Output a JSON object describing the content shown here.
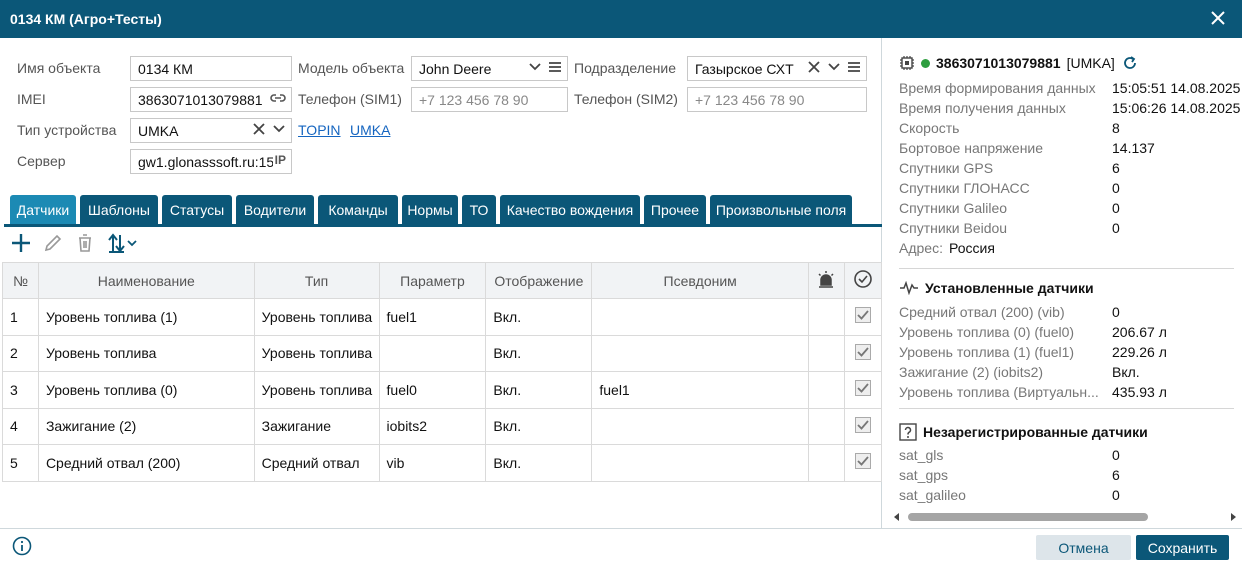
{
  "window": {
    "title": "0134 КМ (Агро+Тесты)"
  },
  "form": {
    "object_name_label": "Имя объекта",
    "object_name_value": "0134 КМ",
    "model_label": "Модель объекта",
    "model_value": "John Deere",
    "division_label": "Подразделение",
    "division_value": "Газырское СХТ",
    "imei_label": "IMEI",
    "imei_value": "3863071013079881",
    "phone1_label": "Телефон (SIM1)",
    "phone1_placeholder": "+7 123 456 78 90",
    "phone2_label": "Телефон (SIM2)",
    "phone2_placeholder": "+7 123 456 78 90",
    "device_type_label": "Тип устройства",
    "device_type_value": "UMKA",
    "link_topin": "TOPIN",
    "link_umka": "UMKA",
    "server_label": "Сервер",
    "server_value": "gw1.glonasssoft.ru:15"
  },
  "tabs": [
    "Датчики",
    "Шаблоны",
    "Статусы",
    "Водители",
    "Команды",
    "Нормы",
    "ТО",
    "Качество вождения",
    "Прочее",
    "Произвольные поля"
  ],
  "table": {
    "headers": [
      "№",
      "Наименование",
      "Тип",
      "Параметр",
      "Отображение",
      "Псевдоним"
    ],
    "rows": [
      [
        "1",
        "Уровень топлива (1)",
        "Уровень топлива",
        "fuel1",
        "Вкл.",
        ""
      ],
      [
        "2",
        "Уровень топлива",
        "Уровень топлива",
        "",
        "Вкл.",
        ""
      ],
      [
        "3",
        "Уровень топлива (0)",
        "Уровень топлива",
        "fuel0",
        "Вкл.",
        "fuel1"
      ],
      [
        "4",
        "Зажигание (2)",
        "Зажигание",
        "iobits2",
        "Вкл.",
        ""
      ],
      [
        "5",
        "Средний отвал (200)",
        "Средний отвал",
        "vib",
        "Вкл.",
        ""
      ]
    ]
  },
  "info": {
    "device_id": "3863071013079881",
    "device_type": "[UMKA]",
    "rows": [
      [
        "Время формирования данных",
        "15:05:51 14.08.2025"
      ],
      [
        "Время получения данных",
        "15:06:26 14.08.2025"
      ],
      [
        "Скорость",
        "8"
      ],
      [
        "Бортовое напряжение",
        "14.137"
      ],
      [
        "Спутники GPS",
        "6"
      ],
      [
        "Спутники ГЛОНАСС",
        "0"
      ],
      [
        "Спутники Galileo",
        "0"
      ],
      [
        "Спутники Beidou",
        "0"
      ]
    ],
    "address_label": "Адрес:",
    "address_value": "Россия",
    "installed_title": "Установленные датчики",
    "installed": [
      [
        "Средний отвал (200) (vib)",
        "0"
      ],
      [
        "Уровень топлива (0) (fuel0)",
        "206.67 л"
      ],
      [
        "Уровень топлива (1) (fuel1)",
        "229.26 л"
      ],
      [
        "Зажигание (2) (iobits2)",
        "Вкл."
      ],
      [
        "Уровень топлива (Виртуальн...",
        "435.93 л"
      ]
    ],
    "unregistered_title": "Незарегистрированные датчики",
    "unregistered": [
      [
        "sat_gls",
        "0"
      ],
      [
        "sat_gps",
        "6"
      ],
      [
        "sat_galileo",
        "0"
      ]
    ]
  },
  "footer": {
    "cancel_label": "Отмена",
    "save_label": "Сохранить"
  },
  "colors": {
    "header_bg": "#0b5778",
    "tab_active": "#1c8ab4",
    "status_online": "#2e9e3f",
    "link": "#1565c0"
  }
}
